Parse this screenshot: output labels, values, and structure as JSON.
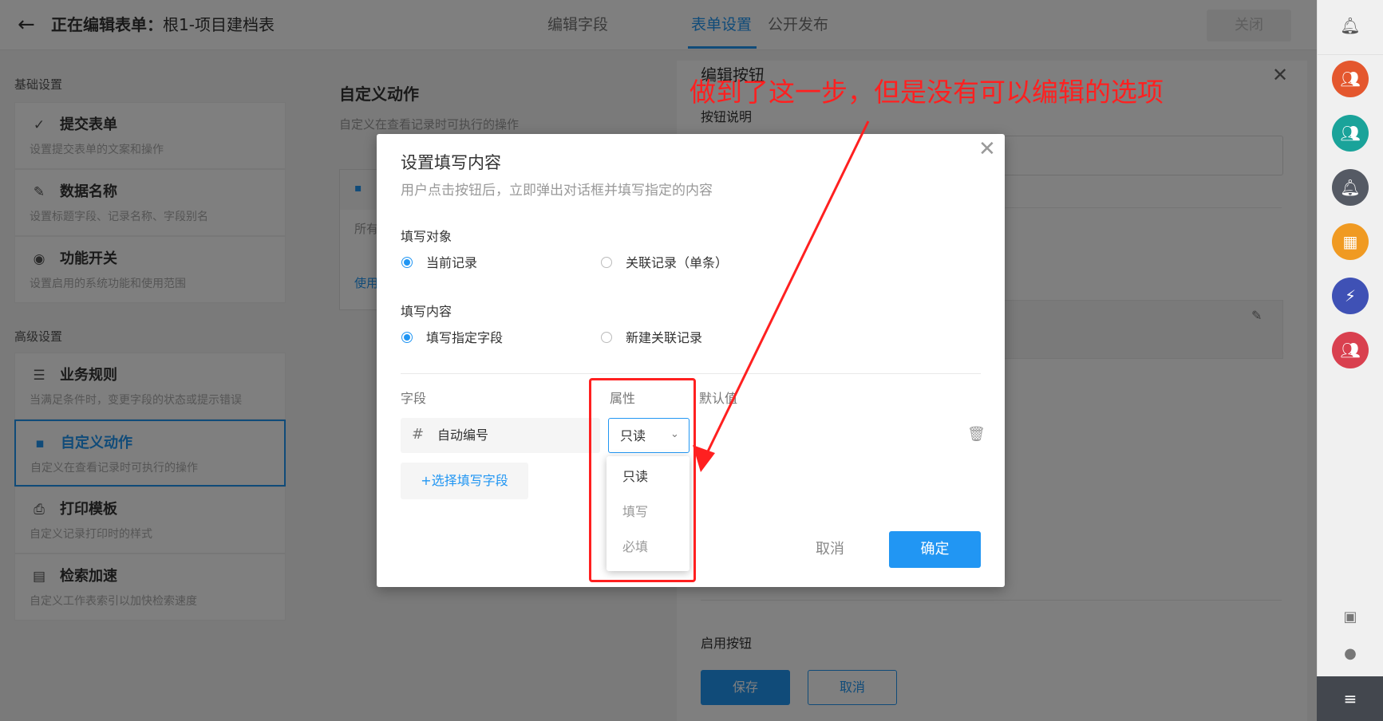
{
  "header": {
    "back_icon": "arrow-left-icon",
    "title_prefix": "正在编辑表单：",
    "title_name": "根1-项目建档表",
    "tabs": [
      "编辑字段",
      "表单设置",
      "公开发布"
    ],
    "active_tab": "表单设置",
    "close_label": "关闭"
  },
  "sidebar": {
    "basic_label": "基础设置",
    "advanced_label": "高级设置",
    "basic_items": [
      {
        "icon": "check-circle-icon",
        "title": "提交表单",
        "desc": "设置提交表单的文案和操作"
      },
      {
        "icon": "pencil-icon",
        "title": "数据名称",
        "desc": "设置标题字段、记录名称、字段别名"
      },
      {
        "icon": "toggle-icon",
        "title": "功能开关",
        "desc": "设置启用的系统功能和使用范围"
      }
    ],
    "advanced_items": [
      {
        "icon": "list-icon",
        "title": "业务规则",
        "desc": "当满足条件时，变更字段的状态或提示错误"
      },
      {
        "icon": "custom-action-icon",
        "title": "自定义动作",
        "desc": "自定义在查看记录时可执行的操作"
      },
      {
        "icon": "printer-icon",
        "title": "打印模板",
        "desc": "自定义记录打印时的样式"
      },
      {
        "icon": "index-icon",
        "title": "检索加速",
        "desc": "自定义工作表索引以加快检索速度"
      }
    ]
  },
  "middle": {
    "title": "自定义动作",
    "desc": "自定义在查看记录时可执行的操作",
    "card_text1": "所有",
    "card_text2": "使用"
  },
  "drawer": {
    "title": "编辑按钮",
    "label_desc": "按钮说明",
    "label_enable": "启用按钮",
    "save_label": "保存",
    "cancel_label": "取消"
  },
  "modal": {
    "title": "设置填写内容",
    "desc": "用户点击按钮后，立即弹出对话框并填写指定的内容",
    "target_label": "填写对象",
    "target_options": [
      "当前记录",
      "关联记录（单条）"
    ],
    "target_selected": 0,
    "content_label": "填写内容",
    "content_options": [
      "填写指定字段",
      "新建关联记录"
    ],
    "content_selected": 0,
    "col_field": "字段",
    "col_attr": "属性",
    "col_default": "默认值",
    "field_name": "自动编号",
    "select_value": "只读",
    "add_field_label": "+选择填写字段",
    "cancel_label": "取消",
    "ok_label": "确定",
    "dropdown_options": [
      "只读",
      "填写",
      "必填"
    ]
  },
  "annotation": {
    "text": "做到了这一步，但是没有可以编辑的选项",
    "color": "#ff2020"
  },
  "rail": {
    "app_colors": [
      "#e4572e",
      "#1aa39a",
      "#555a64",
      "#f09a22",
      "#3f51b5",
      "#d9404f"
    ]
  },
  "colors": {
    "accent": "#2196f3"
  }
}
